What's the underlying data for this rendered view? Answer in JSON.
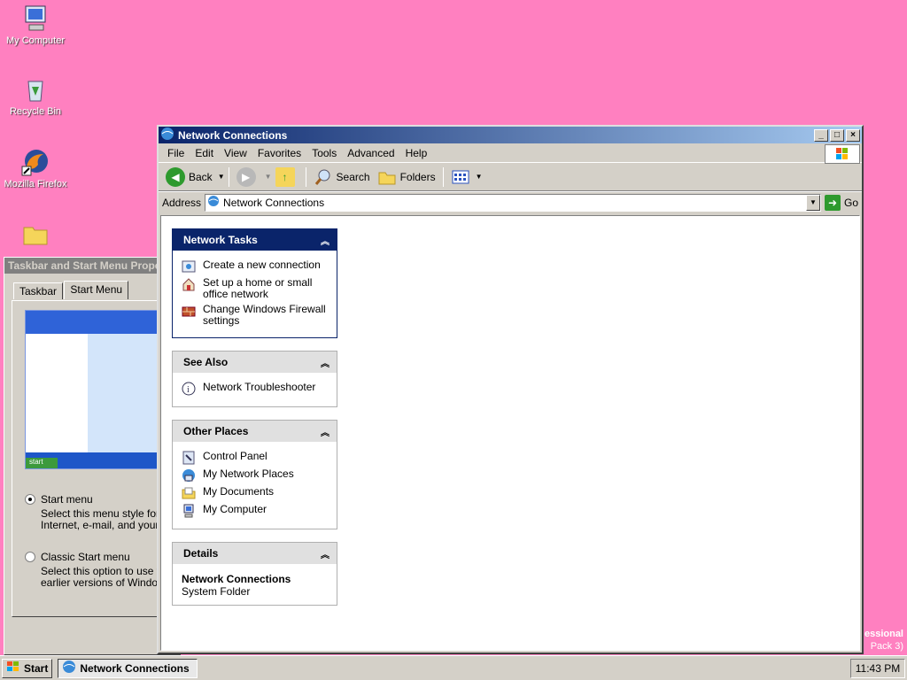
{
  "desktop": {
    "icons": [
      {
        "label": "My Computer"
      },
      {
        "label": "Recycle Bin"
      },
      {
        "label": "Mozilla Firefox"
      },
      {
        "label": ""
      }
    ],
    "watermark_line1": "essional",
    "watermark_line2": "Pack 3)"
  },
  "back_dialog": {
    "title": "Taskbar and Start Menu Prope",
    "tabs": [
      "Taskbar",
      "Start Menu"
    ],
    "options": [
      {
        "label": "Start menu",
        "desc_1": "Select this menu style for ea",
        "desc_2": "Internet, e-mail, and your fav",
        "selected": true
      },
      {
        "label": "Classic Start menu",
        "desc_1": "Select this option to use the",
        "desc_2": "earlier versions of Windows.",
        "selected": false
      }
    ],
    "preview_start": "start"
  },
  "window": {
    "title": "Network Connections",
    "menu": [
      "File",
      "Edit",
      "View",
      "Favorites",
      "Tools",
      "Advanced",
      "Help"
    ],
    "toolbar": {
      "back": "Back",
      "search": "Search",
      "folders": "Folders"
    },
    "address": {
      "label": "Address",
      "value": "Network Connections",
      "go": "Go"
    },
    "panels": {
      "network_tasks": {
        "title": "Network Tasks",
        "links": [
          {
            "label": "Create a new connection",
            "icon": "new-connection-icon"
          },
          {
            "label": "Set up a home or small office network",
            "icon": "home-network-icon"
          },
          {
            "label": "Change Windows Firewall settings",
            "icon": "firewall-icon"
          }
        ]
      },
      "see_also": {
        "title": "See Also",
        "links": [
          {
            "label": "Network Troubleshooter",
            "icon": "info-icon"
          }
        ]
      },
      "other_places": {
        "title": "Other Places",
        "links": [
          {
            "label": "Control Panel",
            "icon": "control-panel-icon"
          },
          {
            "label": "My Network Places",
            "icon": "network-places-icon"
          },
          {
            "label": "My Documents",
            "icon": "documents-icon"
          },
          {
            "label": "My Computer",
            "icon": "computer-icon"
          }
        ]
      },
      "details": {
        "title": "Details",
        "name": "Network Connections",
        "type": "System Folder"
      }
    }
  },
  "taskbar": {
    "start": "Start",
    "task": "Network Connections",
    "clock": "11:43 PM"
  }
}
